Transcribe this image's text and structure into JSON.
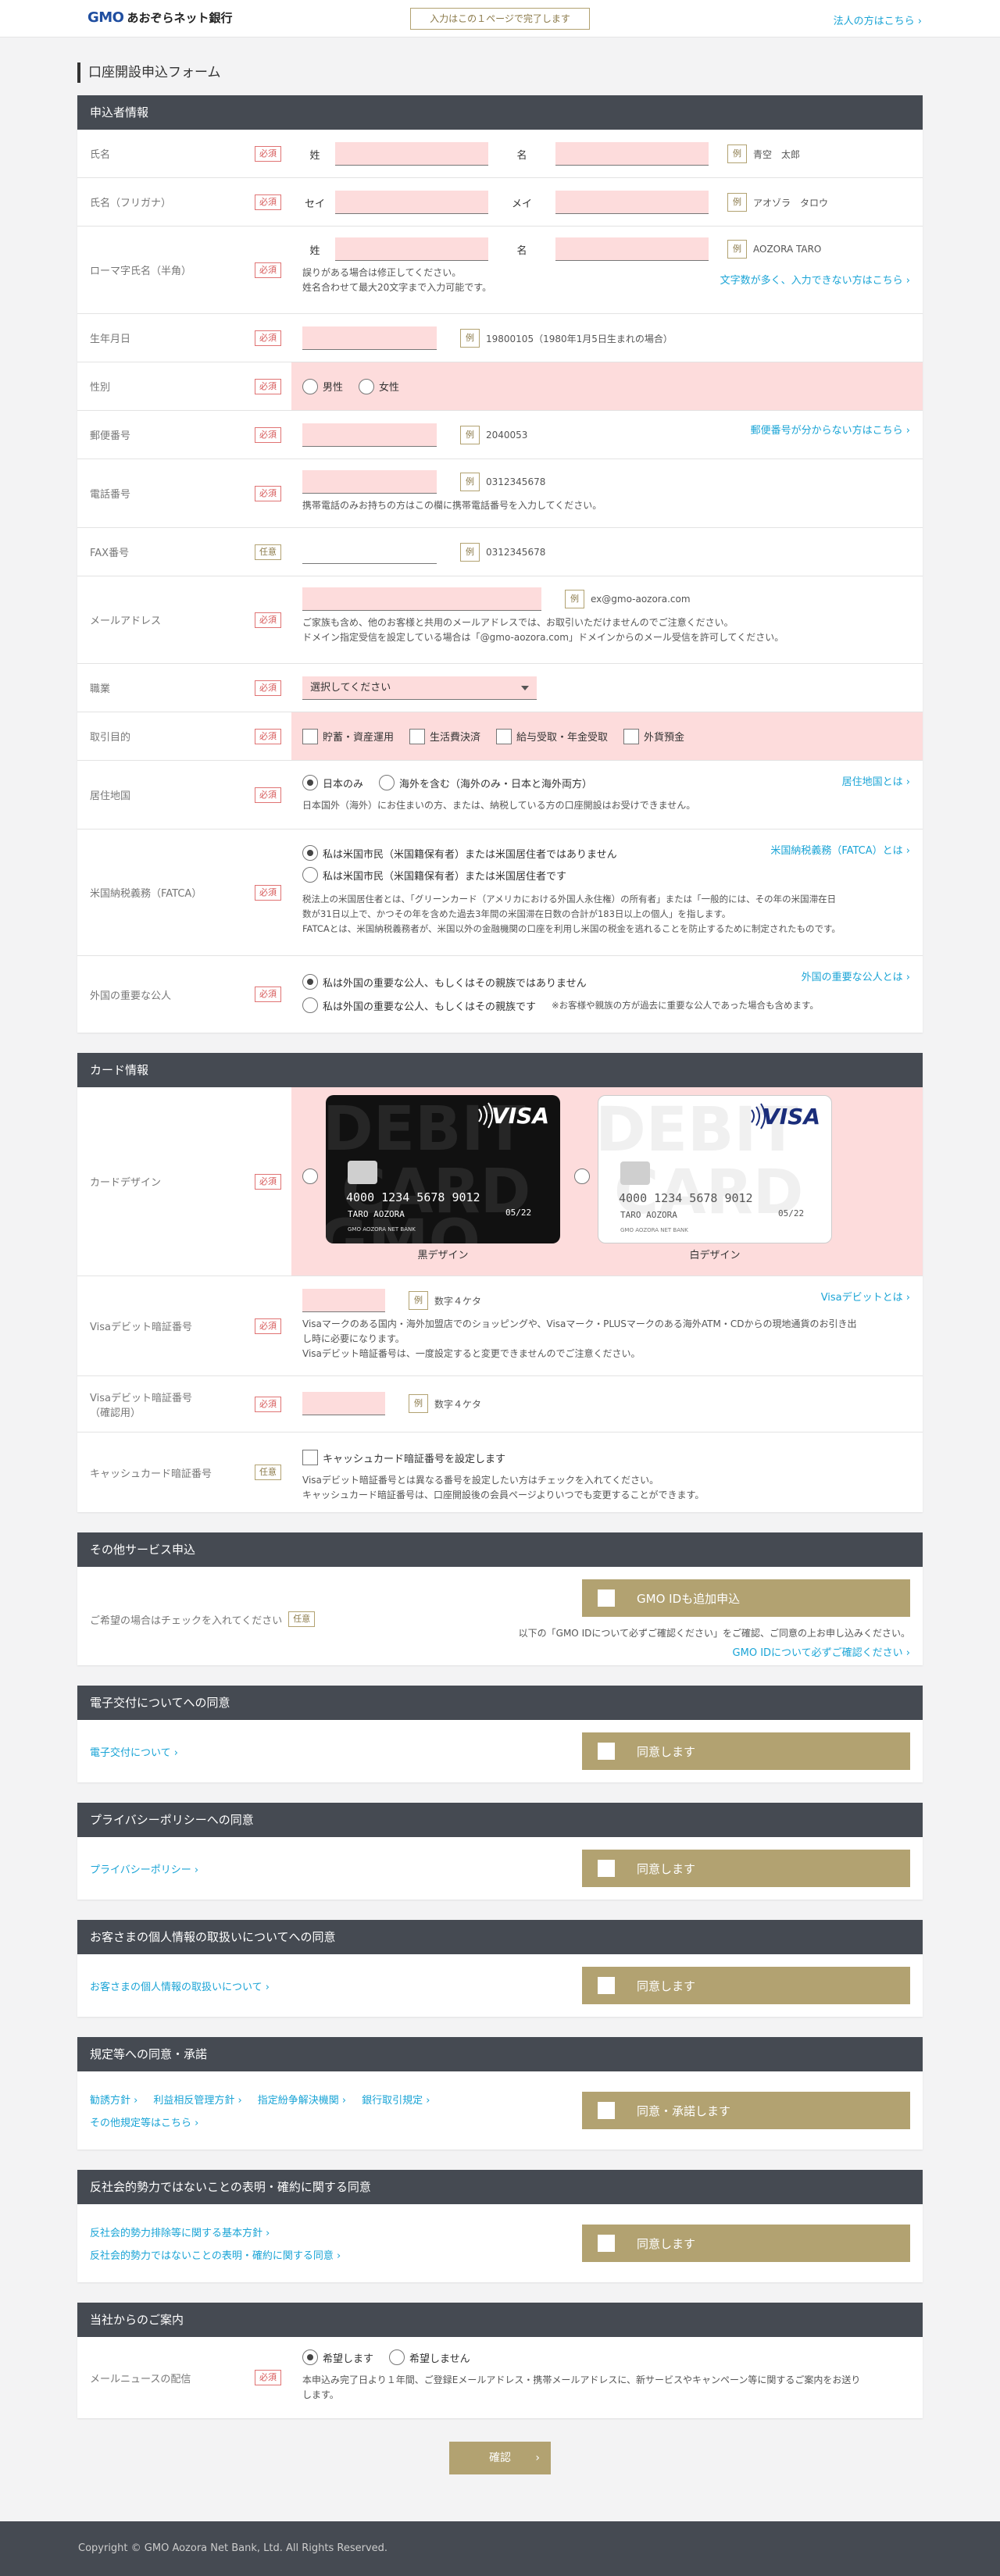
{
  "header": {
    "logo_gmo": "GMO",
    "logo_rest": "あおぞらネット銀行",
    "note": "入力はこの１ページで完了します",
    "corp_link": "法人の方はこちら ›"
  },
  "page_title": "口座開設申込フォーム",
  "badges": {
    "required": "必須",
    "optional": "任意"
  },
  "applicant": {
    "head": "申込者情報",
    "name": {
      "label": "氏名",
      "sei": "姓",
      "mei": "名",
      "ex": "例",
      "ex_val": "青空　太郎"
    },
    "kana": {
      "label": "氏名（フリガナ）",
      "sei": "セイ",
      "mei": "メイ",
      "ex": "例",
      "ex_val": "アオゾラ　タロウ"
    },
    "roma": {
      "label": "ローマ字氏名（半角）",
      "sei": "姓",
      "mei": "名",
      "ex": "例",
      "ex_val": "AOZORA TARO",
      "note1": "誤りがある場合は修正してください。",
      "note2": "姓名合わせて最大20文字まで入力可能です。",
      "link": "文字数が多く、入力できない方はこちら"
    },
    "birth": {
      "label": "生年月日",
      "ex": "例",
      "ex_val": "19800105（1980年1月5日生まれの場合）"
    },
    "gender": {
      "label": "性別",
      "male": "男性",
      "female": "女性"
    },
    "zip": {
      "label": "郵便番号",
      "ex": "例",
      "ex_val": "2040053",
      "link": "郵便番号が分からない方はこちら"
    },
    "tel": {
      "label": "電話番号",
      "ex": "例",
      "ex_val": "0312345678",
      "note": "携帯電話のみお持ちの方はこの欄に携帯電話番号を入力してください。"
    },
    "fax": {
      "label": "FAX番号",
      "ex": "例",
      "ex_val": "0312345678"
    },
    "mail": {
      "label": "メールアドレス",
      "ex": "例",
      "ex_val": "ex@gmo-aozora.com",
      "note1": "ご家族も含め、他のお客様と共用のメールアドレスでは、お取引いただけませんのでご注意ください。",
      "note2": "ドメイン指定受信を設定している場合は「@gmo-aozora.com」ドメインからのメール受信を許可してください。"
    },
    "job": {
      "label": "職業",
      "value": "選択してください"
    },
    "purpose": {
      "label": "取引目的",
      "o1": "貯蓄・資産運用",
      "o2": "生活費決済",
      "o3": "給与受取・年金受取",
      "o4": "外貨預金"
    },
    "residence": {
      "label": "居住地国",
      "o1": "日本のみ",
      "o2": "海外を含む（海外のみ・日本と海外両方）",
      "note": "日本国外（海外）にお住まいの方、または、納税している方の口座開設はお受けできません。",
      "link": "居住地国とは"
    },
    "fatca": {
      "label": "米国納税義務（FATCA）",
      "o1": "私は米国市民（米国籍保有者）または米国居住者ではありません",
      "o2": "私は米国市民（米国籍保有者）または米国居住者です",
      "link": "米国納税義務（FATCA）とは",
      "note1": "税法上の米国居住者とは、「グリーンカード（アメリカにおける外国人永住権）の所有者」または「一般的には、その年の米国滞在日",
      "note2": "数が31日以上で、かつその年を含めた過去3年間の米国滞在日数の合計が183日以上の個人」を指します。",
      "note3": "FATCAとは、米国納税義務者が、米国以外の金融機関の口座を利用し米国の税金を逃れることを防止するために制定されたものです。"
    },
    "pep": {
      "label": "外国の重要な公人",
      "o1": "私は外国の重要な公人、もしくはその親族ではありません",
      "o2": "私は外国の重要な公人、もしくはその親族です",
      "o2note": "※お客様や親族の方が過去に重要な公人であった場合も含めます。",
      "link": "外国の重要な公人とは"
    }
  },
  "card": {
    "head": "カード情報",
    "design": {
      "label": "カードデザイン",
      "black": "黒デザイン",
      "white": "白デザイン",
      "brand": "VISA",
      "number": "4000  1234  5678  9012",
      "valid": "05/22",
      "holder": "TARO AOZORA",
      "bank": "GMO AOZORA NET BANK"
    },
    "pin": {
      "label": "Visaデビット暗証番号",
      "ex": "例",
      "ex_val": "数字４ケタ",
      "link": "Visaデビットとは",
      "note1": "Visaマークのある国内・海外加盟店でのショッピングや、Visaマーク・PLUSマークのある海外ATM・CDからの現地通貨のお引き出",
      "note2": "し時に必要になります。",
      "note3": "Visaデビット暗証番号は、一度設定すると変更できませんのでご注意ください。"
    },
    "pin2": {
      "label1": "Visaデビット暗証番号",
      "label2": "（確認用）",
      "ex": "例",
      "ex_val": "数字４ケタ"
    },
    "cash": {
      "label": "キャッシュカード暗証番号",
      "check": "キャッシュカード暗証番号を設定します",
      "note1": "Visaデビット暗証番号とは異なる番号を設定したい方はチェックを入れてください。",
      "note2": "キャッシュカード暗証番号は、口座開設後の会員ページよりいつでも変更することができます。"
    }
  },
  "other": {
    "head": "その他サービス申込",
    "label": "ご希望の場合はチェックを入れてください",
    "button": "GMO IDも追加申込",
    "note": "以下の「GMO IDについて必ずご確認ください」をご確認、ご同意の上お申し込みください。",
    "link": "GMO IDについて必ずご確認ください"
  },
  "ebook": {
    "head": "電子交付についてへの同意",
    "link": "電子交付について",
    "button": "同意します"
  },
  "privacy": {
    "head": "プライバシーポリシーへの同意",
    "link": "プライバシーポリシー",
    "button": "同意します"
  },
  "personal": {
    "head": "お客さまの個人情報の取扱いについてへの同意",
    "link": "お客さまの個人情報の取扱いについて",
    "button": "同意します"
  },
  "rules": {
    "head": "規定等への同意・承諾",
    "l1": "勧誘方針",
    "l2": "利益相反管理方針",
    "l3": "指定紛争解決機関",
    "l4": "銀行取引規定",
    "l5": "その他規定等はこちら",
    "button": "同意・承諾します"
  },
  "antisocial": {
    "head": "反社会的勢力ではないことの表明・確約に関する同意",
    "l1": "反社会的勢力排除等に関する基本方針",
    "l2": "反社会的勢力ではないことの表明・確約に関する同意",
    "button": "同意します"
  },
  "notice": {
    "head": "当社からのご案内",
    "label": "メールニュースの配信",
    "o1": "希望します",
    "o2": "希望しません",
    "note1": "本申込み完了日より１年間、ご登録Eメールアドレス・携帯メールアドレスに、新サービスやキャンペーン等に関するご案内をお送り",
    "note2": "します。"
  },
  "confirm": "確認",
  "footer": "Copyright © GMO Aozora Net Bank, Ltd. All Rights Reserved."
}
